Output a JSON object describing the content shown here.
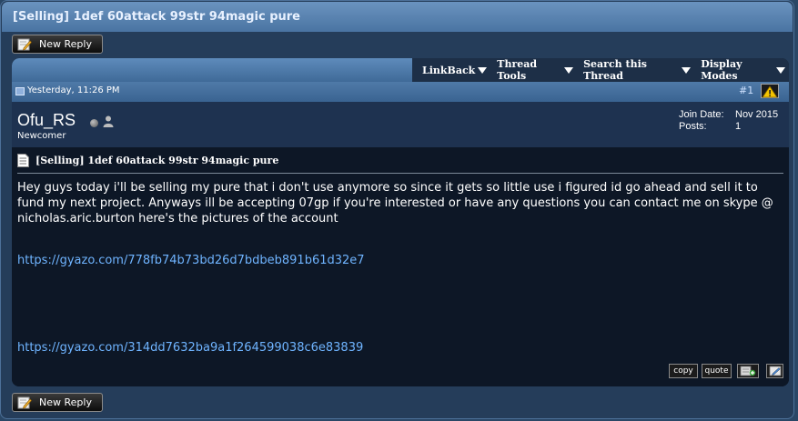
{
  "thread": {
    "title": "[Selling] 1def 60attack 99str 94magic pure"
  },
  "buttons": {
    "new_reply_top": "New Reply",
    "new_reply_bottom": "New Reply"
  },
  "toolbar": {
    "items": [
      "LinkBack",
      "Thread Tools",
      "Search this Thread",
      "Display Modes"
    ]
  },
  "post": {
    "date": "Yesterday, 11:26 PM",
    "number": "#1",
    "username": "Ofu_RS",
    "user_title": "Newcomer",
    "join_date_label": "Join Date:",
    "join_date_value": "Nov 2015",
    "posts_label": "Posts:",
    "posts_value": "1",
    "title": "[Selling] 1def 60attack 99str 94magic pure",
    "message": "Hey guys today i'll be selling my pure that i don't use anymore so since it gets so little use i figured id go ahead and sell it to fund my next project. Anyways ill be accepting 07gp if you're interested or have any questions you can contact me on skype @ nicholas.aric.burton here's the pictures of the account",
    "link_1": "https://gyazo.com/778fb74b73bd26d7bdbeb891b61d32e7",
    "link_2": "https://gyazo.com/314dd7632ba9a1f264599038c6e83839",
    "actions": {
      "copy": "copy",
      "quote": "quote"
    }
  },
  "icons": {
    "online_status": "offline-dot-icon",
    "profile": "user-icon",
    "report": "warning-icon",
    "document": "document-icon",
    "multiquote": "multiquote-icon",
    "quick_reply": "quick-reply-icon",
    "reply": "pencil-icon"
  },
  "colors": {
    "link": "#6fb4ff",
    "title_bar": "#5a84b2",
    "post_background": "#0d1726"
  }
}
